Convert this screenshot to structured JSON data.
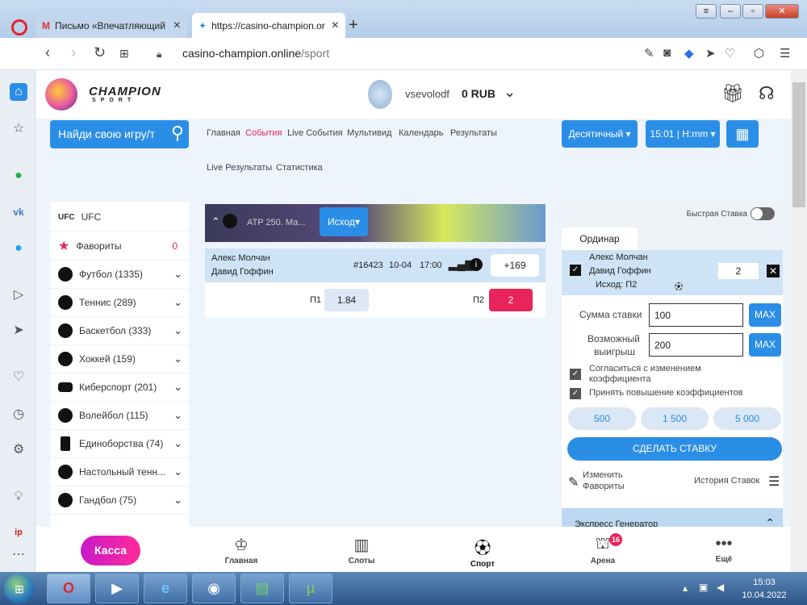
{
  "browser": {
    "tabs": [
      {
        "title": "Письмо «Впечатляющий ..."
      },
      {
        "title": "https://casino-champion.or"
      }
    ],
    "new_tab": "+",
    "url_host": "casino-champion.online",
    "url_path": "/sport"
  },
  "header": {
    "logo_top": "CHAMPION",
    "logo_bottom": "SPORT",
    "username": "vsevolodf",
    "balance": "0 RUB"
  },
  "search": {
    "placeholder": "Найди свою игру/т"
  },
  "menu": [
    "Главная",
    "События",
    "Live События",
    "Мультивид",
    "Календарь",
    "Результаты",
    "Live Результаты",
    "Статистика"
  ],
  "controls": {
    "odds_format": "Десятичный",
    "time_format": "15:01 | H:mm"
  },
  "sports": [
    {
      "label": "UFC"
    },
    {
      "label": "Фавориты",
      "count": "0"
    },
    {
      "label": "Футбол (1335)"
    },
    {
      "label": "Теннис (289)"
    },
    {
      "label": "Баскетбол (333)"
    },
    {
      "label": "Хоккей (159)"
    },
    {
      "label": "Киберспорт (201)"
    },
    {
      "label": "Волейбол (115)"
    },
    {
      "label": "Единоборства (74)"
    },
    {
      "label": "Настольный тенн..."
    },
    {
      "label": "Гандбол (75)"
    }
  ],
  "event": {
    "banner_title": "ATP 250. Ма...",
    "outcome_btn": "Исход",
    "player1": "Алекс Молчан",
    "player2": "Давид Гоффин",
    "id": "#16423",
    "date": "10-04",
    "time": "17:00",
    "more": "+169",
    "p1_label": "П1",
    "p1_odds": "1.84",
    "p2_label": "П2",
    "p2_odds": "2"
  },
  "slip": {
    "quick_bet": "Быстрая Ставка",
    "tab": "Ординар",
    "player1": "Алекс Молчан",
    "player2": "Давид Гоффин",
    "outcome": "Исход: П2",
    "odds": "2",
    "stake_label": "Сумма ставки",
    "stake": "100",
    "win_label_1": "Возможный",
    "win_label_2": "выигрыш",
    "win": "200",
    "max": "MAX",
    "agree_1": "Согласиться с изменением",
    "agree_2": "коэффициента",
    "accept": "Принять повышение коэффициентов",
    "quick": [
      "500",
      "1 500",
      "5 000"
    ],
    "place": "СДЕЛАТЬ СТАВКУ",
    "edit_fav_1": "Изменить",
    "edit_fav_2": "Фавориты",
    "history": "История Ставок",
    "express": "Экспресс Генератор"
  },
  "bottom_nav": {
    "kassa": "Касса",
    "items": [
      {
        "label": "Главная"
      },
      {
        "label": "Слоты"
      },
      {
        "label": "Спорт"
      },
      {
        "label": "Арена",
        "badge": "16"
      },
      {
        "label": "Ещё"
      }
    ]
  },
  "taskbar": {
    "time": "15:03",
    "date": "10.04.2022"
  },
  "colors": {
    "accent": "#2b8ee6",
    "pink": "#e8245a",
    "kassa": "#d61bc0"
  }
}
